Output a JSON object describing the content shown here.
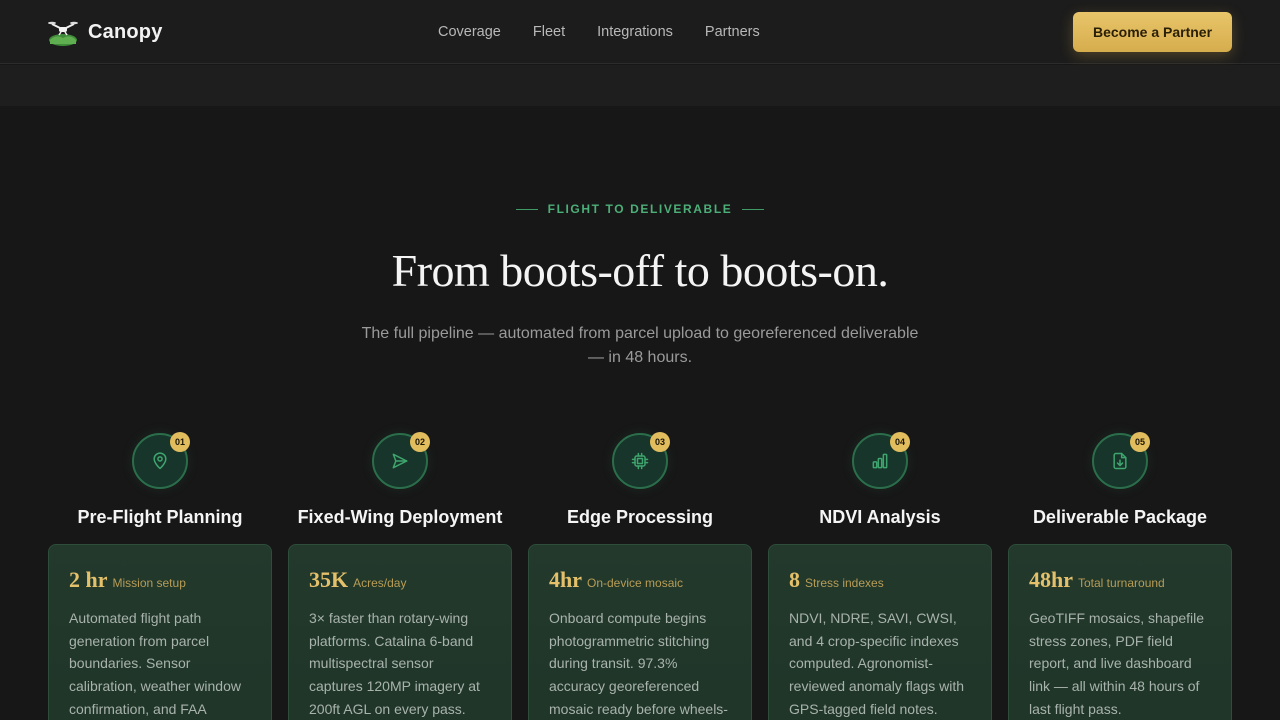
{
  "nav": {
    "brand": "Canopy",
    "links": [
      "Coverage",
      "Fleet",
      "Integrations",
      "Partners"
    ],
    "cta": "Become a Partner"
  },
  "hero": {
    "eyebrow": "FLIGHT TO DELIVERABLE",
    "headline": "From boots-off to boots-on.",
    "subhead": "The full pipeline — automated from parcel upload to georeferenced deliverable — in 48 hours."
  },
  "steps": [
    {
      "num": "01",
      "icon": "map-pin-icon",
      "title": "Pre-Flight Planning",
      "stat_value": "2 hr",
      "stat_label": "Mission setup",
      "text": "Automated flight path generation from parcel boundaries. Sensor calibration, weather window confirmation, and FAA"
    },
    {
      "num": "02",
      "icon": "send-icon",
      "title": "Fixed-Wing Deployment",
      "stat_value": "35K",
      "stat_label": "Acres/day",
      "text": "3× faster than rotary-wing platforms. Catalina 6-band multispectral sensor captures 120MP imagery at 200ft AGL on every pass."
    },
    {
      "num": "03",
      "icon": "cpu-icon",
      "title": "Edge Processing",
      "stat_value": "4hr",
      "stat_label": "On-device mosaic",
      "text": "Onboard compute begins photogrammetric stitching during transit. 97.3% accuracy georeferenced mosaic ready before wheels-"
    },
    {
      "num": "04",
      "icon": "bar-chart-icon",
      "title": "NDVI Analysis",
      "stat_value": "8",
      "stat_label": "Stress indexes",
      "text": "NDVI, NDRE, SAVI, CWSI, and 4 crop-specific indexes computed. Agronomist-reviewed anomaly flags with GPS-tagged field notes."
    },
    {
      "num": "05",
      "icon": "file-download-icon",
      "title": "Deliverable Package",
      "stat_value": "48hr",
      "stat_label": "Total turnaround",
      "text": "GeoTIFF mosaics, shapefile stress zones, PDF field report, and live dashboard link — all within 48 hours of last flight pass."
    }
  ],
  "colors": {
    "accent_gold": "#e2bd5e",
    "accent_green": "#4caf78",
    "card_bg": "#22392c"
  }
}
